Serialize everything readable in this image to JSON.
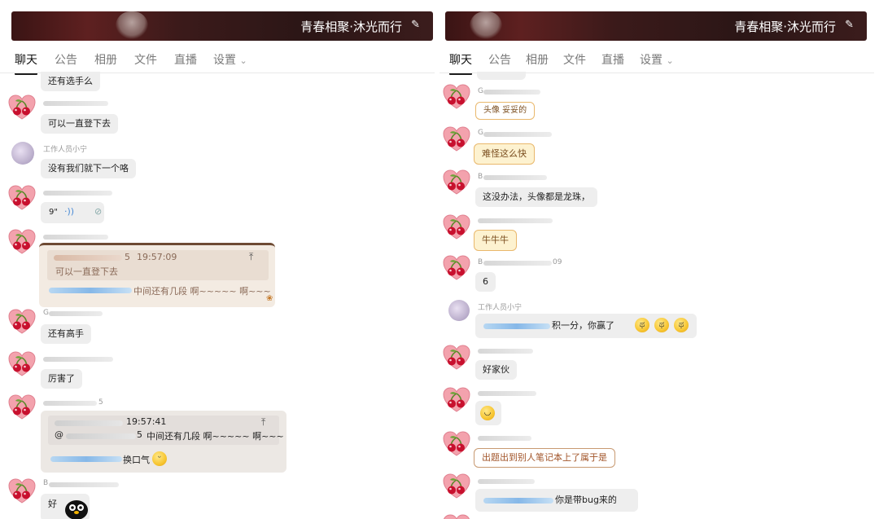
{
  "colors": {
    "banner": "#4a1a1a",
    "bubble": "#eeeeee",
    "cream_bubble": "#fdf2d0",
    "accent_blur": "#86b8e8",
    "tab_active": "#111111"
  },
  "left": {
    "group_title": "青春相聚·沐光而行",
    "edit_icon": "pencil-icon",
    "tabs": [
      "聊天",
      "公告",
      "相册",
      "文件",
      "直播",
      "设置"
    ],
    "settings_chevron": "⌄",
    "messages": {
      "m0": "还有选手么",
      "m1": "可以一直登下去",
      "m2_name": "工作人员小宁",
      "m2": "没有我们就下一个咯",
      "m3_voice": "9\"",
      "m4_time": "19:57:09",
      "m4_quote": "可以一直登下去",
      "m4_suffix_char": "5",
      "m4_text": "中间还有几段 啊~~~~~ 啊~~~",
      "m5_name": "G",
      "m5": "还有高手",
      "m6": "厉害了",
      "m7_name_suffix": "5",
      "m7_time": "19:57:41",
      "m7_quote_prefix": "@",
      "m7_quote_suffix_char": "5",
      "m7_quote": "中间还有几段 啊~~~~~ 啊~~~",
      "m7_text": "换口气",
      "m8_name": "B",
      "m8": "好"
    }
  },
  "right": {
    "group_title": "青春相聚·沐光而行",
    "edit_icon": "pencil-icon",
    "tabs": [
      "聊天",
      "公告",
      "相册",
      "文件",
      "直播",
      "设置"
    ],
    "settings_chevron": "⌄",
    "messages": {
      "r1_name": "G",
      "r1": "头像 妥妥的",
      "r2_name": "G",
      "r2": "难怪这么快",
      "r3_name": "B",
      "r3": "这没办法，头像都是龙珠，",
      "r4": "牛牛牛",
      "r5_name": "B",
      "r5_name_tail": "09",
      "r5": "6",
      "r6_name": "工作人员小宁",
      "r6": "积一分，你赢了",
      "r7": "好家伙",
      "r9": "出题出到别人笔记本上了属于是",
      "r10": "你是带bug来的"
    }
  }
}
